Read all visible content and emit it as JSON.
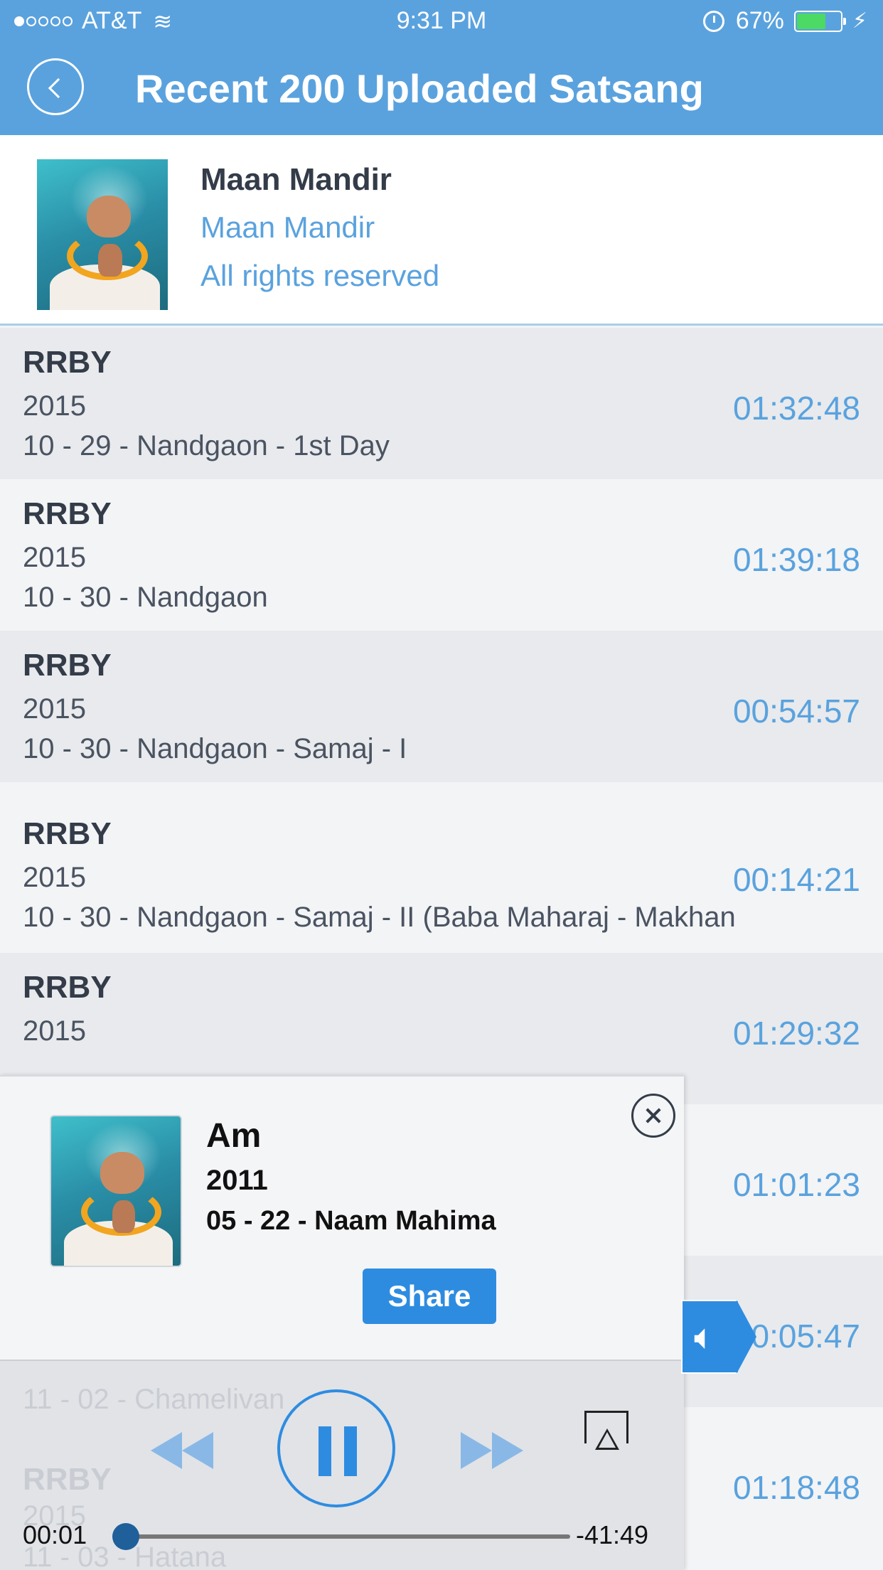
{
  "status_bar": {
    "carrier": "AT&T",
    "time": "9:31 PM",
    "battery": "67%",
    "battery_level": 0.67
  },
  "header": {
    "title": "Recent 200 Uploaded Satsang",
    "back_icon": "chevron-left-icon"
  },
  "info": {
    "title": "Maan Mandir",
    "subtitle": "Maan Mandir",
    "rights": "All rights reserved"
  },
  "list": [
    {
      "title": "RRBY",
      "year": "2015",
      "desc": "10 - 29 - Nandgaon - 1st Day",
      "duration": "01:32:48"
    },
    {
      "title": "RRBY",
      "year": "2015",
      "desc": "10 - 30 - Nandgaon",
      "duration": "01:39:18"
    },
    {
      "title": "RRBY",
      "year": "2015",
      "desc": "10 - 30 - Nandgaon - Samaj - I",
      "duration": "00:54:57"
    },
    {
      "title": "RRBY",
      "year": "2015",
      "desc": "10 - 30 - Nandgaon - Samaj - II (Baba Maharaj - Makhan",
      "duration": "00:14:21"
    },
    {
      "title": "RRBY",
      "year": "2015",
      "desc": "",
      "duration": "01:29:32"
    },
    {
      "title": "",
      "year": "",
      "desc": "",
      "duration": "01:01:23"
    },
    {
      "title": "",
      "year": "",
      "desc": "",
      "duration": "00:05:47"
    },
    {
      "title": "",
      "year": "",
      "desc": "",
      "duration": "01:18:48"
    }
  ],
  "player": {
    "title": "Am",
    "year": "2011",
    "desc": "05 - 22 - Naam Mahima",
    "share_label": "Share",
    "elapsed": "00:01",
    "remaining": "-41:49",
    "progress": 0.0004,
    "ghost_desc_1": "11 - 02 - Chamelivan",
    "ghost_title": "RRBY",
    "ghost_year": "2015",
    "ghost_desc_2": "11 - 03 - Hatana"
  },
  "colors": {
    "accent": "#5aa2de",
    "button": "#2e8ce0",
    "battery": "#4cd964"
  }
}
